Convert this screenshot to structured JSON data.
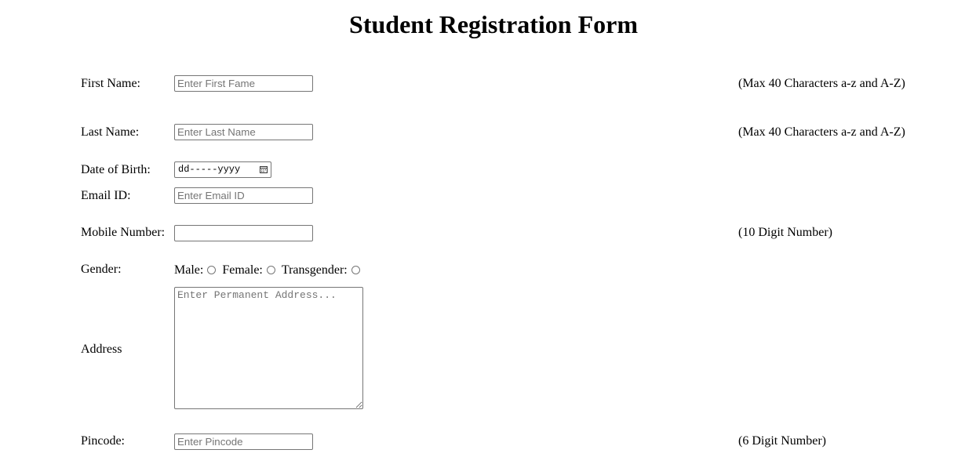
{
  "form": {
    "title": "Student Registration Form",
    "first_name": {
      "label": "First Name:",
      "placeholder": "Enter First Fame",
      "hint": "(Max 40 Characters a-z and A-Z)"
    },
    "last_name": {
      "label": "Last Name:",
      "placeholder": "Enter Last Name",
      "hint": "(Max 40 Characters a-z and A-Z)"
    },
    "dob": {
      "label": "Date of Birth:",
      "value": "dd-----yyyy",
      "icon": "calendar-icon"
    },
    "email": {
      "label": "Email ID:",
      "placeholder": "Enter Email ID"
    },
    "mobile": {
      "label": "Mobile Number:",
      "placeholder": "",
      "hint": "(10 Digit Number)"
    },
    "gender": {
      "label": "Gender:",
      "options": [
        "Male:",
        "Female:",
        "Transgender:"
      ]
    },
    "address": {
      "label": "Address",
      "placeholder": "Enter Permanent Address..."
    },
    "pincode": {
      "label": "Pincode:",
      "placeholder": "Enter Pincode",
      "hint": "(6 Digit Number)"
    }
  }
}
